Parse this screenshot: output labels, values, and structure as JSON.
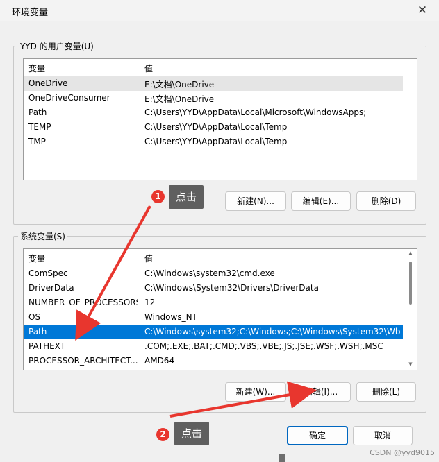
{
  "window": {
    "title": "环境变量",
    "close_glyph": "✕"
  },
  "user_section": {
    "label": "YYD 的用户变量(U)",
    "columns": [
      "变量",
      "值"
    ],
    "rows": [
      {
        "name": "OneDrive",
        "value": "E:\\文档\\OneDrive"
      },
      {
        "name": "OneDriveConsumer",
        "value": "E:\\文档\\OneDrive"
      },
      {
        "name": "Path",
        "value": "C:\\Users\\YYD\\AppData\\Local\\Microsoft\\WindowsApps;"
      },
      {
        "name": "TEMP",
        "value": "C:\\Users\\YYD\\AppData\\Local\\Temp"
      },
      {
        "name": "TMP",
        "value": "C:\\Users\\YYD\\AppData\\Local\\Temp"
      }
    ],
    "buttons": {
      "new": "新建(N)...",
      "edit": "编辑(E)...",
      "delete": "删除(D)"
    }
  },
  "system_section": {
    "label": "系统变量(S)",
    "columns": [
      "变量",
      "值"
    ],
    "rows": [
      {
        "name": "ComSpec",
        "value": "C:\\Windows\\system32\\cmd.exe"
      },
      {
        "name": "DriverData",
        "value": "C:\\Windows\\System32\\Drivers\\DriverData"
      },
      {
        "name": "NUMBER_OF_PROCESSORS",
        "value": "12"
      },
      {
        "name": "OS",
        "value": "Windows_NT"
      },
      {
        "name": "Path",
        "value": "C:\\Windows\\system32;C:\\Windows;C:\\Windows\\System32\\Wb..."
      },
      {
        "name": "PATHEXT",
        "value": ".COM;.EXE;.BAT;.CMD;.VBS;.VBE;.JS;.JSE;.WSF;.WSH;.MSC"
      },
      {
        "name": "PROCESSOR_ARCHITECT...",
        "value": "AMD64"
      }
    ],
    "buttons": {
      "new": "新建(W)...",
      "edit": "编辑(I)...",
      "delete": "删除(L)"
    }
  },
  "footer": {
    "ok": "确定",
    "cancel": "取消"
  },
  "annotations": [
    {
      "number": "1",
      "text": "点击"
    },
    {
      "number": "2",
      "text": "点击"
    }
  ],
  "watermark": "CSDN @yyd9015",
  "colors": {
    "selection": "#0078d7",
    "arrow": "#e8362e",
    "callout_bg": "#5f5f5f"
  }
}
